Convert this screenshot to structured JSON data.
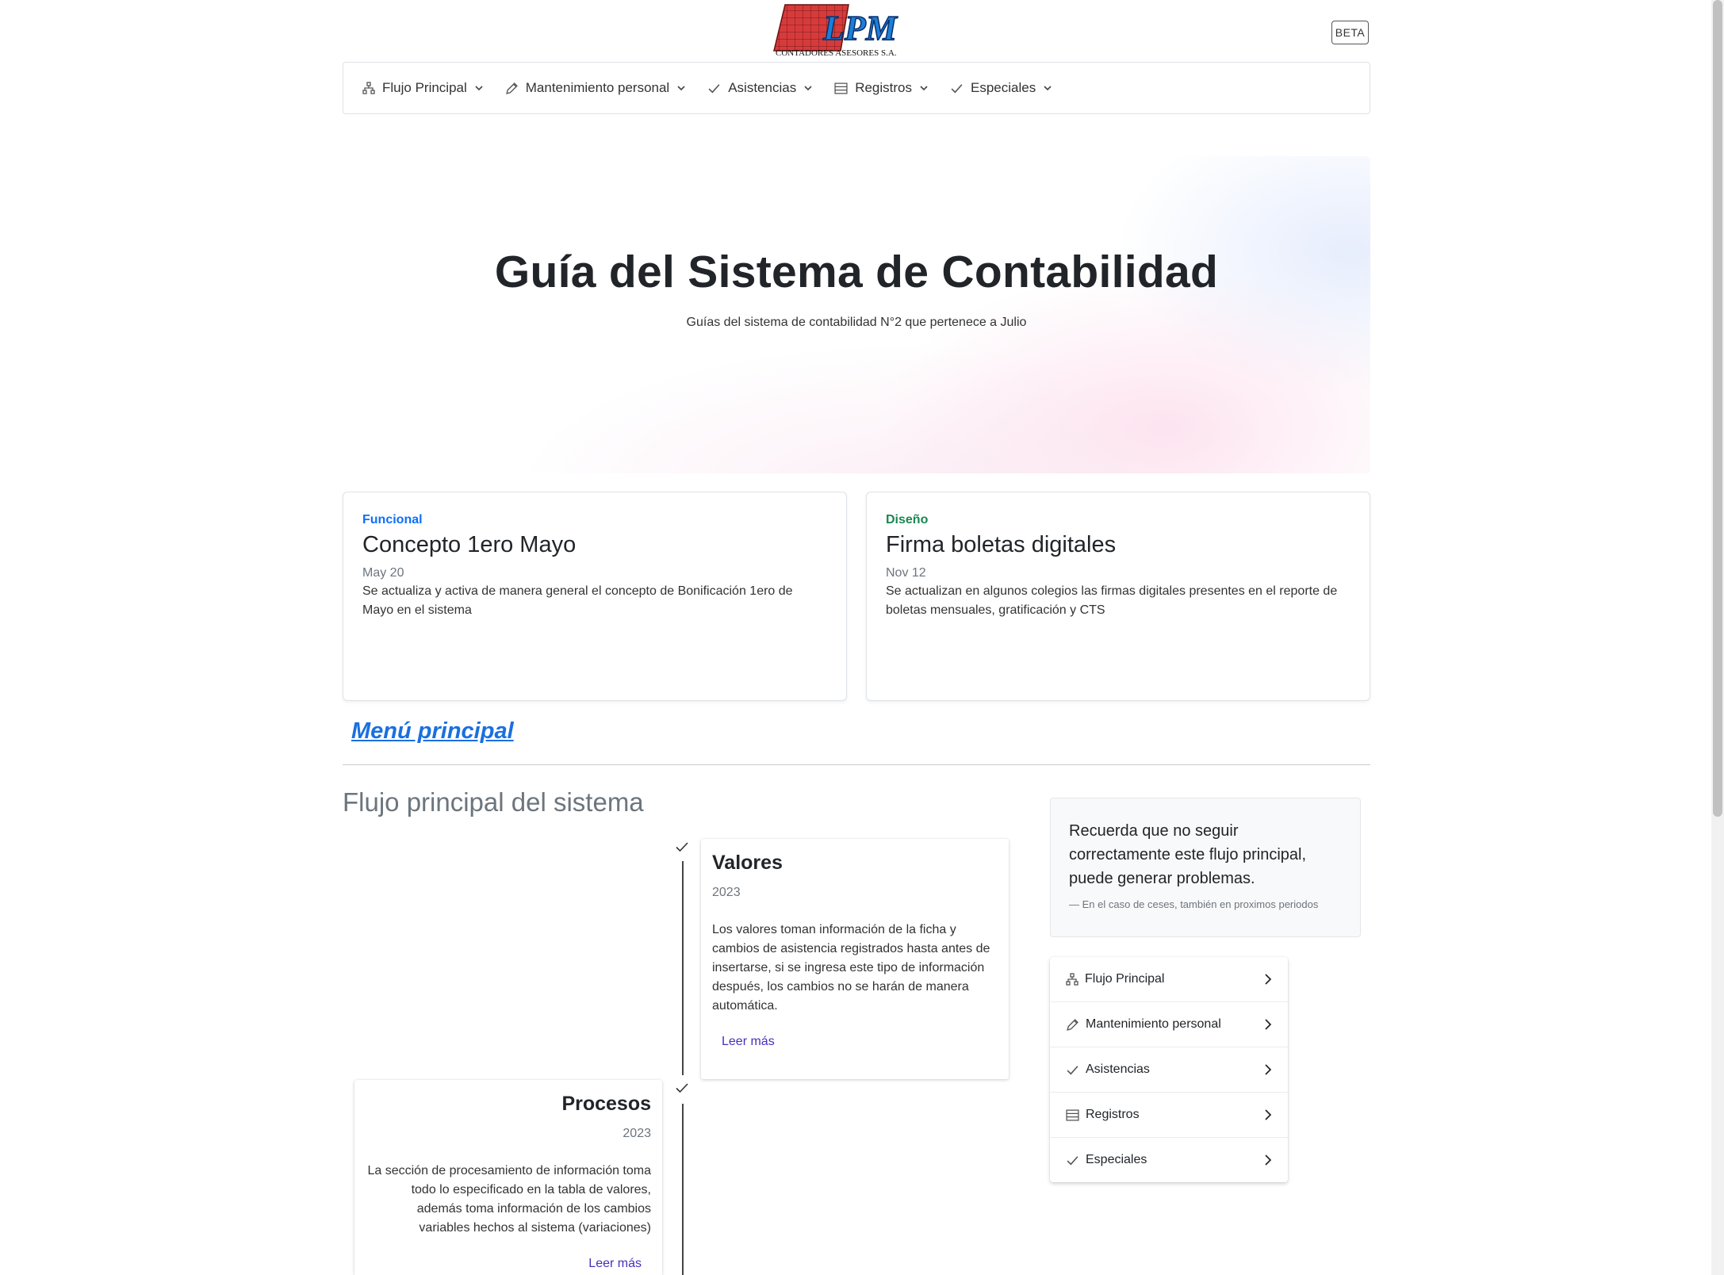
{
  "header": {
    "logo_text": "LPM",
    "logo_subtext": "CONTADORES ASESORES S.A.",
    "beta_badge": "BETA"
  },
  "nav": {
    "items": [
      {
        "label": "Flujo Principal",
        "icon": "sitemap-icon"
      },
      {
        "label": "Mantenimiento personal",
        "icon": "pencil-icon"
      },
      {
        "label": "Asistencias",
        "icon": "check-icon"
      },
      {
        "label": "Registros",
        "icon": "table-icon"
      },
      {
        "label": "Especiales",
        "icon": "check-icon"
      }
    ]
  },
  "hero": {
    "title": "Guía del Sistema de Contabilidad",
    "subtitle": "Guías del sistema de contabilidad N°2 que pertenece a Julio"
  },
  "cards": [
    {
      "category": "Funcional",
      "category_color": "#0d6efd",
      "title": "Concepto 1ero Mayo",
      "date": "May 20",
      "description": "Se actualiza y activa de manera general el concepto de Bonificación 1ero de Mayo en el sistema"
    },
    {
      "category": "Diseño",
      "category_color": "#198754",
      "title": "Firma boletas digitales",
      "date": "Nov 12",
      "description": "Se actualizan en algunos colegios las firmas digitales presentes en el reporte de boletas mensuales, gratificación y CTS"
    }
  ],
  "menu_link": "Menú principal",
  "section_title": "Flujo principal del sistema",
  "timeline": [
    {
      "title": "Valores",
      "year": "2023",
      "text": "Los valores toman información de la ficha y cambios de asistencia registrados hasta antes de insertarse, si se ingresa este tipo de información después, los cambios no se harán de manera automática.",
      "link": "Leer más"
    },
    {
      "title": "Procesos",
      "year": "2023",
      "text": "La sección de procesamiento de información toma todo lo especificado en la tabla de valores, además toma información de los cambios variables hechos al sistema (variaciones)",
      "link": "Leer más"
    }
  ],
  "quote": {
    "text": "Recuerda que no seguir correctamente este flujo principal, puede generar problemas.",
    "footer": "En el caso de ceses, también en proximos periodos"
  },
  "side_list": {
    "items": [
      {
        "label": "Flujo Principal",
        "icon": "sitemap-icon"
      },
      {
        "label": "Mantenimiento personal",
        "icon": "pencil-icon"
      },
      {
        "label": "Asistencias",
        "icon": "check-icon"
      },
      {
        "label": "Registros",
        "icon": "table-icon"
      },
      {
        "label": "Especiales",
        "icon": "check-icon"
      }
    ]
  }
}
